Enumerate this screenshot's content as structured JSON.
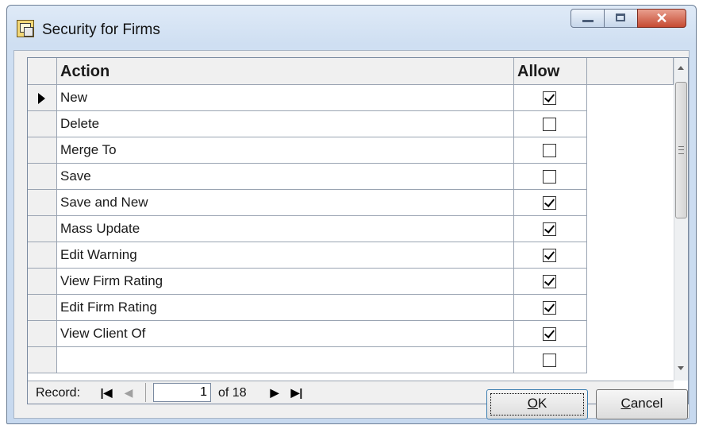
{
  "window": {
    "title": "Security for Firms"
  },
  "grid": {
    "columns": {
      "action": "Action",
      "allow": "Allow"
    },
    "rows": [
      {
        "action": "New",
        "allow": true,
        "current": true
      },
      {
        "action": "Delete",
        "allow": false
      },
      {
        "action": "Merge To",
        "allow": false
      },
      {
        "action": "Save",
        "allow": false
      },
      {
        "action": "Save and New",
        "allow": true
      },
      {
        "action": "Mass Update",
        "allow": true
      },
      {
        "action": "Edit Warning",
        "allow": true
      },
      {
        "action": "View Firm Rating",
        "allow": true
      },
      {
        "action": "Edit Firm Rating",
        "allow": true
      },
      {
        "action": "View Client Of",
        "allow": true
      },
      {
        "action": "",
        "allow": false
      }
    ]
  },
  "navigator": {
    "label": "Record:",
    "current": "1",
    "of_text": "of 18"
  },
  "buttons": {
    "ok_pre": "",
    "ok_accel": "O",
    "ok_post": "K",
    "cancel_accel": "C",
    "cancel_post": "ancel"
  },
  "icons": {
    "app": "form-icon",
    "first": "first-record-icon",
    "prev": "previous-record-icon",
    "next": "next-record-icon",
    "last": "last-record-icon"
  }
}
